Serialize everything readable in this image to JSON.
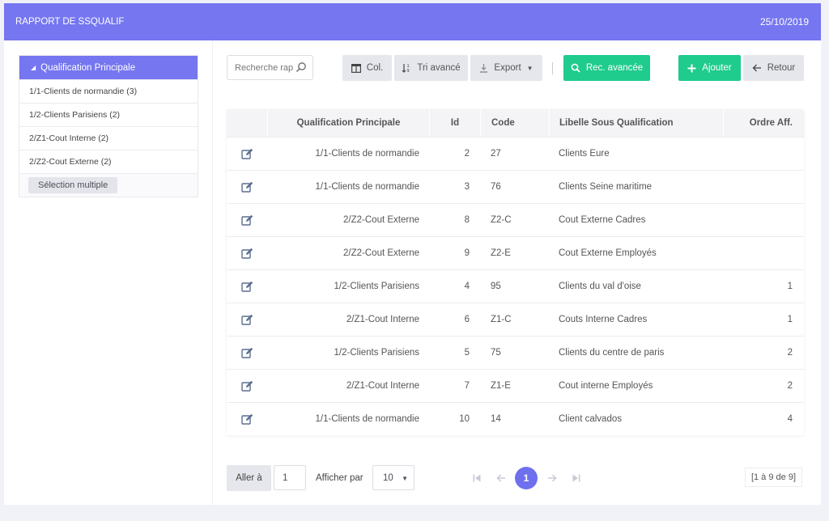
{
  "header": {
    "title": "RAPPORT DE SSQUALIF",
    "date": "25/10/2019"
  },
  "sidebar": {
    "root_label": "Qualification Principale",
    "items": [
      {
        "label": "1/1-Clients de normandie (3)"
      },
      {
        "label": "1/2-Clients Parisiens (2)"
      },
      {
        "label": "2/Z1-Cout Interne (2)"
      },
      {
        "label": "2/Z2-Cout Externe (2)"
      }
    ],
    "multi_select_label": "Sélection multiple"
  },
  "toolbar": {
    "search_placeholder": "Recherche rapide",
    "columns_label": "Col.",
    "sort_label": "Tri avancé",
    "export_label": "Export",
    "advanced_search_label": "Rec. avancée",
    "add_label": "Ajouter",
    "back_label": "Retour"
  },
  "table": {
    "columns": [
      "Qualification Principale",
      "Id",
      "Code",
      "Libelle Sous Qualification",
      "Ordre Aff."
    ],
    "rows": [
      {
        "qp": "1/1-Clients de normandie",
        "id": "2",
        "code": "27",
        "lib": "Clients Eure",
        "ord": ""
      },
      {
        "qp": "1/1-Clients de normandie",
        "id": "3",
        "code": "76",
        "lib": "Clients Seine maritime",
        "ord": ""
      },
      {
        "qp": "2/Z2-Cout Externe",
        "id": "8",
        "code": "Z2-C",
        "lib": "Cout Externe Cadres",
        "ord": ""
      },
      {
        "qp": "2/Z2-Cout Externe",
        "id": "9",
        "code": "Z2-E",
        "lib": "Cout Externe Employés",
        "ord": ""
      },
      {
        "qp": "1/2-Clients Parisiens",
        "id": "4",
        "code": "95",
        "lib": "Clients du val d'oise",
        "ord": "1"
      },
      {
        "qp": "2/Z1-Cout Interne",
        "id": "6",
        "code": "Z1-C",
        "lib": "Couts Interne Cadres",
        "ord": "1"
      },
      {
        "qp": "1/2-Clients Parisiens",
        "id": "5",
        "code": "75",
        "lib": "Clients du centre de paris",
        "ord": "2"
      },
      {
        "qp": "2/Z1-Cout Interne",
        "id": "7",
        "code": "Z1-E",
        "lib": "Cout interne Employés",
        "ord": "2"
      },
      {
        "qp": "1/1-Clients de normandie",
        "id": "10",
        "code": "14",
        "lib": "Client calvados",
        "ord": "4"
      }
    ]
  },
  "pager": {
    "goto_label": "Aller à",
    "goto_value": "1",
    "show_label": "Afficher par",
    "per_page": "10",
    "current_page": "1",
    "range": "[1 à 9 de 9]"
  },
  "colors": {
    "accent": "#7576f0",
    "green": "#1fcb8d"
  }
}
